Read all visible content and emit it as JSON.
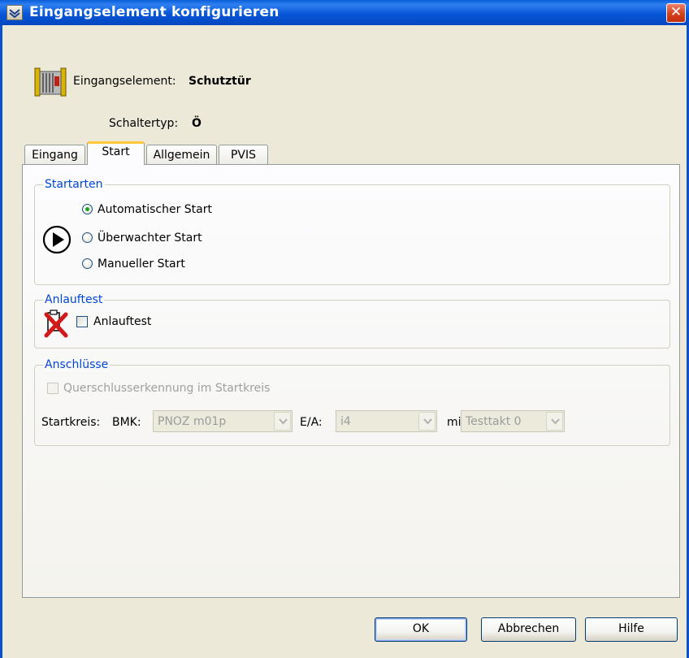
{
  "window": {
    "title": "Eingangselement konfigurieren",
    "close_symbol": "✕"
  },
  "header": {
    "element_label": "Eingangselement:",
    "element_value": "Schutztür",
    "switch_label": "Schaltertyp:",
    "switch_value": "Ö",
    "icon": "safety-door-icon"
  },
  "tabs": [
    {
      "label": "Eingang",
      "active": false
    },
    {
      "label": "Start",
      "active": true
    },
    {
      "label": "Allgemein",
      "active": false
    },
    {
      "label": "PVIS",
      "active": false
    }
  ],
  "startarten": {
    "title": "Startarten",
    "icon": "play-icon",
    "options": [
      {
        "label": "Automatischer Start",
        "selected": true
      },
      {
        "label": "Überwachter Start",
        "selected": false
      },
      {
        "label": "Manueller Start",
        "selected": false
      }
    ]
  },
  "anlauftest": {
    "title": "Anlauftest",
    "icon": "disabled-test-icon",
    "checkbox_label": "Anlauftest",
    "checked": false
  },
  "anschluesse": {
    "title": "Anschlüsse",
    "checkbox_label": "Querschlusserkennung im Startkreis",
    "checked": false,
    "startkreis_label": "Startkreis:",
    "bmk_label": "BMK:",
    "bmk_value": "PNOZ m01p",
    "ea_label": "E/A:",
    "ea_value": "i4",
    "mit_label": "mit:",
    "mit_value": "Testtakt 0"
  },
  "buttons": {
    "ok": "OK",
    "cancel": "Abbrechen",
    "help": "Hilfe"
  },
  "colors": {
    "titlebar": "#0757d8",
    "group_title": "#0046d5",
    "active_tab_highlight": "#ffc83c",
    "radio_selected": "#21a121"
  }
}
